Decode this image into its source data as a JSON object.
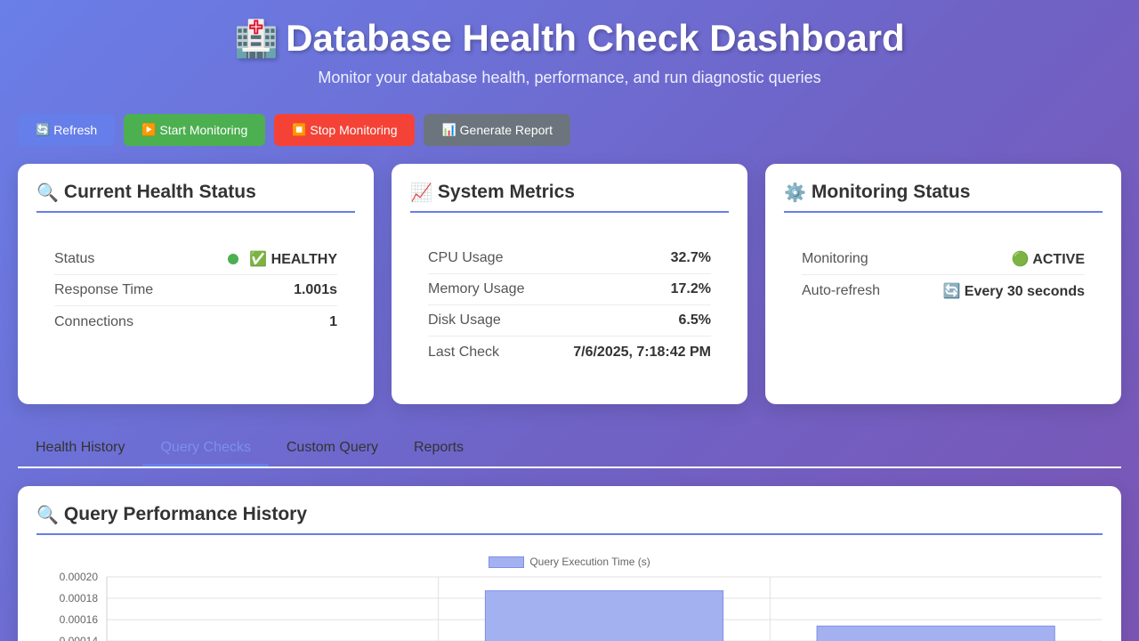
{
  "header": {
    "icon": "hospital-icon",
    "emoji": "🏥",
    "title": "Database Health Check Dashboard",
    "subtitle": "Monitor your database health, performance, and run diagnostic queries"
  },
  "toolbar": {
    "refresh": {
      "icon": "🔄",
      "label": "Refresh"
    },
    "start": {
      "icon": "▶️",
      "label": "Start Monitoring"
    },
    "stop": {
      "icon": "⏹️",
      "label": "Stop Monitoring"
    },
    "report": {
      "icon": "📊",
      "label": "Generate Report"
    }
  },
  "health_card": {
    "emoji": "🔍",
    "title": "Current Health Status",
    "status_label": "Status",
    "status_value": "✅ HEALTHY",
    "response_label": "Response Time",
    "response_value": "1.001s",
    "connections_label": "Connections",
    "connections_value": "1"
  },
  "metrics_card": {
    "emoji": "📈",
    "title": "System Metrics",
    "cpu_label": "CPU Usage",
    "cpu_value": "32.7%",
    "memory_label": "Memory Usage",
    "memory_value": "17.2%",
    "disk_label": "Disk Usage",
    "disk_value": "6.5%",
    "lastcheck_label": "Last Check",
    "lastcheck_value": "7/6/2025, 7:18:42 PM"
  },
  "monitoring_card": {
    "emoji": "⚙️",
    "title": "Monitoring Status",
    "monitoring_label": "Monitoring",
    "monitoring_value": "🟢 ACTIVE",
    "autorefresh_label": "Auto-refresh",
    "autorefresh_value": "🔄 Every 30 seconds"
  },
  "tabs": [
    {
      "label": "Health History",
      "active": false
    },
    {
      "label": "Query Checks",
      "active": true
    },
    {
      "label": "Custom Query",
      "active": false
    },
    {
      "label": "Reports",
      "active": false
    }
  ],
  "chart_card": {
    "emoji": "🔍",
    "title": "Query Performance History"
  },
  "chart_data": {
    "type": "bar",
    "legend": "Query Execution Time (s)",
    "yticks": [
      "0.00020",
      "0.00018",
      "0.00016",
      "0.00014"
    ],
    "ylim": [
      0.00014,
      0.0002
    ],
    "values": [
      null,
      0.000187,
      0.000154
    ],
    "bar_color": "#a3b1f1",
    "bar_border": "#7f8fe6"
  },
  "colors": {
    "accent": "#667eea",
    "healthy": "#4caf50",
    "stop": "#f44336",
    "neutral": "#6c757d"
  }
}
